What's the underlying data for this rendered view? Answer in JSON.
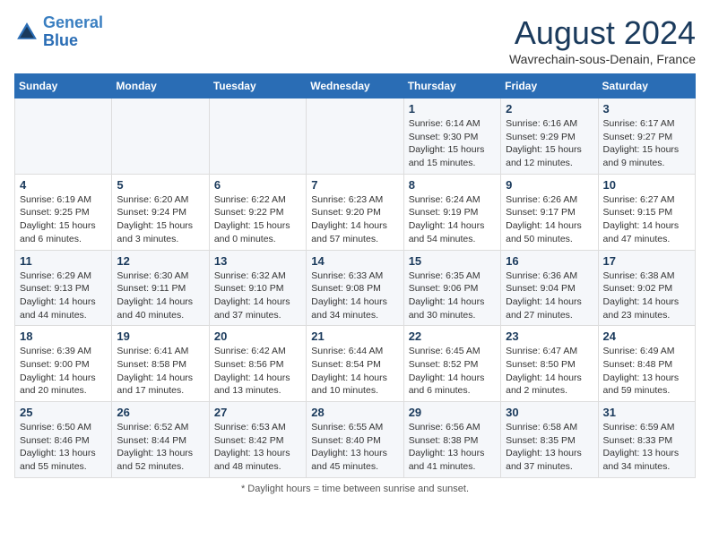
{
  "header": {
    "logo_line1": "General",
    "logo_line2": "Blue",
    "month_title": "August 2024",
    "location": "Wavrechain-sous-Denain, France"
  },
  "footer": {
    "note": "Daylight hours"
  },
  "columns": [
    "Sunday",
    "Monday",
    "Tuesday",
    "Wednesday",
    "Thursday",
    "Friday",
    "Saturday"
  ],
  "weeks": [
    [
      {
        "day": "",
        "info": ""
      },
      {
        "day": "",
        "info": ""
      },
      {
        "day": "",
        "info": ""
      },
      {
        "day": "",
        "info": ""
      },
      {
        "day": "1",
        "info": "Sunrise: 6:14 AM\nSunset: 9:30 PM\nDaylight: 15 hours\nand 15 minutes."
      },
      {
        "day": "2",
        "info": "Sunrise: 6:16 AM\nSunset: 9:29 PM\nDaylight: 15 hours\nand 12 minutes."
      },
      {
        "day": "3",
        "info": "Sunrise: 6:17 AM\nSunset: 9:27 PM\nDaylight: 15 hours\nand 9 minutes."
      }
    ],
    [
      {
        "day": "4",
        "info": "Sunrise: 6:19 AM\nSunset: 9:25 PM\nDaylight: 15 hours\nand 6 minutes."
      },
      {
        "day": "5",
        "info": "Sunrise: 6:20 AM\nSunset: 9:24 PM\nDaylight: 15 hours\nand 3 minutes."
      },
      {
        "day": "6",
        "info": "Sunrise: 6:22 AM\nSunset: 9:22 PM\nDaylight: 15 hours\nand 0 minutes."
      },
      {
        "day": "7",
        "info": "Sunrise: 6:23 AM\nSunset: 9:20 PM\nDaylight: 14 hours\nand 57 minutes."
      },
      {
        "day": "8",
        "info": "Sunrise: 6:24 AM\nSunset: 9:19 PM\nDaylight: 14 hours\nand 54 minutes."
      },
      {
        "day": "9",
        "info": "Sunrise: 6:26 AM\nSunset: 9:17 PM\nDaylight: 14 hours\nand 50 minutes."
      },
      {
        "day": "10",
        "info": "Sunrise: 6:27 AM\nSunset: 9:15 PM\nDaylight: 14 hours\nand 47 minutes."
      }
    ],
    [
      {
        "day": "11",
        "info": "Sunrise: 6:29 AM\nSunset: 9:13 PM\nDaylight: 14 hours\nand 44 minutes."
      },
      {
        "day": "12",
        "info": "Sunrise: 6:30 AM\nSunset: 9:11 PM\nDaylight: 14 hours\nand 40 minutes."
      },
      {
        "day": "13",
        "info": "Sunrise: 6:32 AM\nSunset: 9:10 PM\nDaylight: 14 hours\nand 37 minutes."
      },
      {
        "day": "14",
        "info": "Sunrise: 6:33 AM\nSunset: 9:08 PM\nDaylight: 14 hours\nand 34 minutes."
      },
      {
        "day": "15",
        "info": "Sunrise: 6:35 AM\nSunset: 9:06 PM\nDaylight: 14 hours\nand 30 minutes."
      },
      {
        "day": "16",
        "info": "Sunrise: 6:36 AM\nSunset: 9:04 PM\nDaylight: 14 hours\nand 27 minutes."
      },
      {
        "day": "17",
        "info": "Sunrise: 6:38 AM\nSunset: 9:02 PM\nDaylight: 14 hours\nand 23 minutes."
      }
    ],
    [
      {
        "day": "18",
        "info": "Sunrise: 6:39 AM\nSunset: 9:00 PM\nDaylight: 14 hours\nand 20 minutes."
      },
      {
        "day": "19",
        "info": "Sunrise: 6:41 AM\nSunset: 8:58 PM\nDaylight: 14 hours\nand 17 minutes."
      },
      {
        "day": "20",
        "info": "Sunrise: 6:42 AM\nSunset: 8:56 PM\nDaylight: 14 hours\nand 13 minutes."
      },
      {
        "day": "21",
        "info": "Sunrise: 6:44 AM\nSunset: 8:54 PM\nDaylight: 14 hours\nand 10 minutes."
      },
      {
        "day": "22",
        "info": "Sunrise: 6:45 AM\nSunset: 8:52 PM\nDaylight: 14 hours\nand 6 minutes."
      },
      {
        "day": "23",
        "info": "Sunrise: 6:47 AM\nSunset: 8:50 PM\nDaylight: 14 hours\nand 2 minutes."
      },
      {
        "day": "24",
        "info": "Sunrise: 6:49 AM\nSunset: 8:48 PM\nDaylight: 13 hours\nand 59 minutes."
      }
    ],
    [
      {
        "day": "25",
        "info": "Sunrise: 6:50 AM\nSunset: 8:46 PM\nDaylight: 13 hours\nand 55 minutes."
      },
      {
        "day": "26",
        "info": "Sunrise: 6:52 AM\nSunset: 8:44 PM\nDaylight: 13 hours\nand 52 minutes."
      },
      {
        "day": "27",
        "info": "Sunrise: 6:53 AM\nSunset: 8:42 PM\nDaylight: 13 hours\nand 48 minutes."
      },
      {
        "day": "28",
        "info": "Sunrise: 6:55 AM\nSunset: 8:40 PM\nDaylight: 13 hours\nand 45 minutes."
      },
      {
        "day": "29",
        "info": "Sunrise: 6:56 AM\nSunset: 8:38 PM\nDaylight: 13 hours\nand 41 minutes."
      },
      {
        "day": "30",
        "info": "Sunrise: 6:58 AM\nSunset: 8:35 PM\nDaylight: 13 hours\nand 37 minutes."
      },
      {
        "day": "31",
        "info": "Sunrise: 6:59 AM\nSunset: 8:33 PM\nDaylight: 13 hours\nand 34 minutes."
      }
    ]
  ]
}
